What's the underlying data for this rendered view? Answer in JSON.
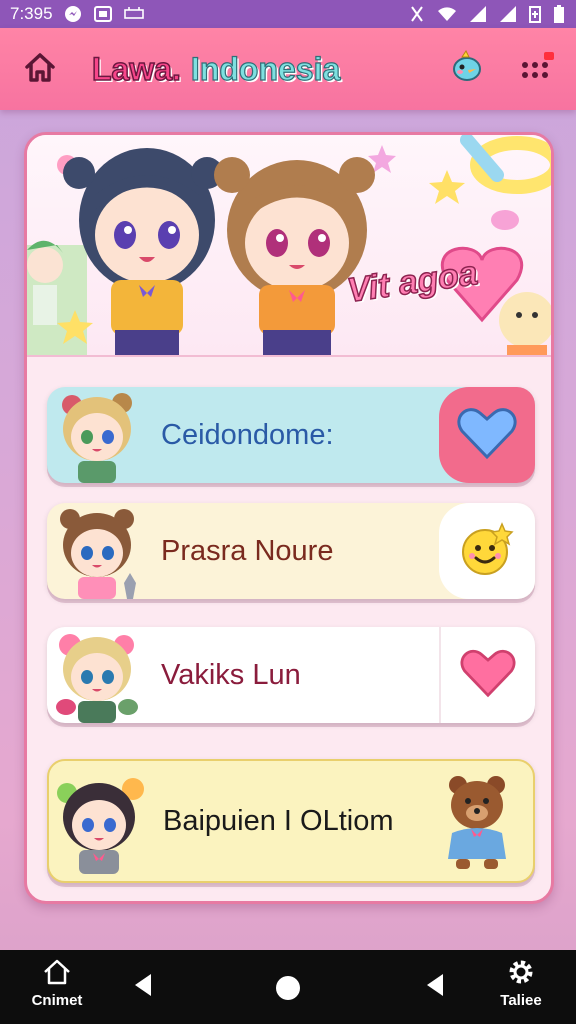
{
  "status_bar": {
    "time": "7:395",
    "icons": [
      "messenger-icon",
      "photo-icon",
      "voicemail-icon",
      "vibrate-icon",
      "wifi-icon",
      "signal-icon",
      "signal-icon",
      "battery-saver-icon",
      "battery-icon"
    ]
  },
  "header": {
    "title_part1": "Lawa.",
    "title_part2": "Indonesia",
    "home_icon": "home-icon",
    "mascot_icon": "bird-mascot-icon",
    "menu_icon": "grid-menu-icon",
    "accent": "#f773a0",
    "notification_color": "#ff2f3c"
  },
  "banner": {
    "text": "Vit agoa"
  },
  "cards": [
    {
      "label": "Ceidondome:",
      "action_icon": "heart-icon",
      "avatar": "blonde-girl-avatar",
      "color": "#bfe9ee"
    },
    {
      "label": "Prasra Noure",
      "action_icon": "smiley-star-icon",
      "avatar": "brown-hair-girl-avatar",
      "color": "#fcf3d8"
    },
    {
      "label": "Vakiks Lun",
      "action_icon": "heart-icon",
      "avatar": "blonde-pigtail-girl-avatar",
      "color": "#ffffff"
    },
    {
      "label": "Baipuien I OLtiom",
      "action_icon": "bear-icon",
      "avatar": "dark-hair-boy-avatar",
      "color": "#fbf3bf"
    }
  ],
  "bottom_nav": {
    "left_label": "Cnimet",
    "right_label": "Taliee",
    "left_icon": "home-icon",
    "right_icon": "gear-icon"
  }
}
